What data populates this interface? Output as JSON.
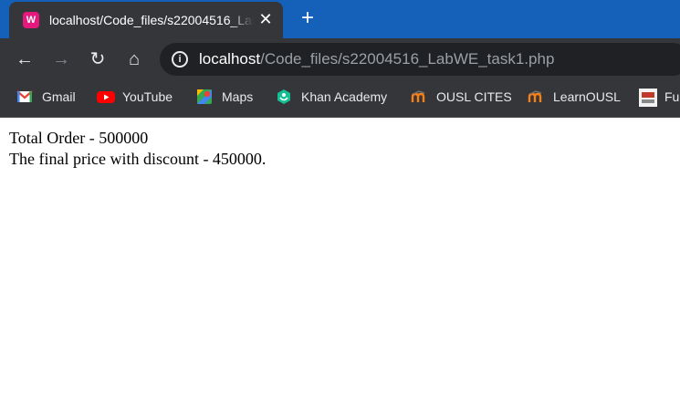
{
  "browser": {
    "tab": {
      "title": "localhost/Code_files/s22004516_LabWE_task1.php",
      "favicon": "wampserver-icon",
      "favicon_letter": "W",
      "close_glyph": "✕"
    },
    "new_tab_glyph": "+",
    "nav": {
      "back_glyph": "←",
      "forward_glyph": "→",
      "reload_glyph": "↻",
      "home_glyph": "⌂"
    },
    "address": {
      "host": "localhost",
      "path": "/Code_files/s22004516_LabWE_task1.php"
    },
    "bookmarks": [
      {
        "label": "Gmail",
        "icon": "gmail-icon"
      },
      {
        "label": "YouTube",
        "icon": "youtube-icon"
      },
      {
        "label": "Maps",
        "icon": "maps-icon"
      },
      {
        "label": "Khan Academy",
        "icon": "khan-academy-icon"
      },
      {
        "label": "OUSL CITES",
        "icon": "moodle-icon"
      },
      {
        "label": "LearnOUSL",
        "icon": "moodle-icon"
      },
      {
        "label": "Fu",
        "icon": "bookmark-image-icon"
      }
    ],
    "colors": {
      "tab_strip": "#1560b8",
      "toolbar": "#35363a",
      "omnibox": "#202124"
    }
  },
  "page": {
    "lines": [
      "Total Order - 500000",
      "The final price with discount - 450000."
    ]
  }
}
